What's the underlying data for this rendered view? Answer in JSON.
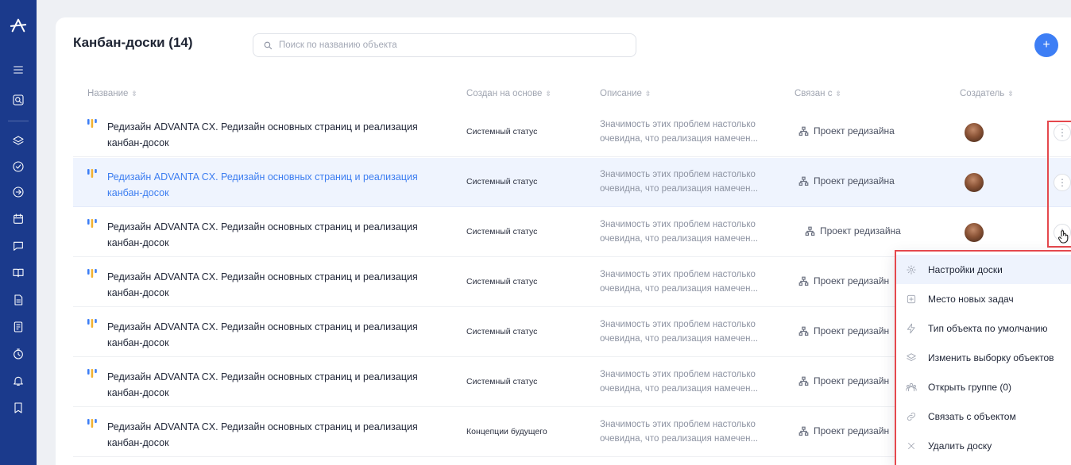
{
  "page": {
    "title": "Канбан-доски (14)",
    "search_placeholder": "Поиск по названию объекта",
    "add_label": "+"
  },
  "columns": [
    {
      "label": "Название"
    },
    {
      "label": "Создан на основе"
    },
    {
      "label": "Описание"
    },
    {
      "label": "Связан с"
    },
    {
      "label": "Создатель"
    }
  ],
  "rows": [
    {
      "name_line1": "Редизайн ADVANTA CX. Редизайн основных страниц и реализация",
      "name_line2": "канбан-досок",
      "based_on": "Системный статус",
      "desc_line1": "Значимость этих проблем настолько",
      "desc_line2": "очевидна, что реализация намечен...",
      "linked": "Проект редизайна"
    },
    {
      "name_line1": "Редизайн ADVANTA CX. Редизайн основных страниц и реализация",
      "name_line2": "канбан-досок",
      "based_on": "Системный статус",
      "desc_line1": "Значимость этих проблем настолько",
      "desc_line2": "очевидна, что реализация намечен...",
      "linked": "Проект редизайна"
    },
    {
      "name_line1": "Редизайн ADVANTA CX. Редизайн основных страниц и реализация",
      "name_line2": "канбан-досок",
      "based_on": "Системный статус",
      "desc_line1": "Значимость этих проблем настолько",
      "desc_line2": "очевидна, что реализация намечен...",
      "linked": "Проект редизайна"
    },
    {
      "name_line1": "Редизайн ADVANTA CX. Редизайн основных страниц и реализация",
      "name_line2": "канбан-досок",
      "based_on": "Системный статус",
      "desc_line1": "Значимость этих проблем настолько",
      "desc_line2": "очевидна, что реализация намечен...",
      "linked": "Проект редизайн"
    },
    {
      "name_line1": "Редизайн ADVANTA CX. Редизайн основных страниц и реализация",
      "name_line2": "канбан-досок",
      "based_on": "Системный статус",
      "desc_line1": "Значимость этих проблем настолько",
      "desc_line2": "очевидна, что реализация намечен...",
      "linked": "Проект редизайн"
    },
    {
      "name_line1": "Редизайн ADVANTA CX. Редизайн основных страниц и реализация",
      "name_line2": "канбан-досок",
      "based_on": "Системный статус",
      "desc_line1": "Значимость этих проблем настолько",
      "desc_line2": "очевидна, что реализация намечен...",
      "linked": "Проект редизайн"
    },
    {
      "name_line1": "Редизайн ADVANTA CX. Редизайн основных страниц и реализация",
      "name_line2": "канбан-досок",
      "based_on": "Концепции будущего",
      "desc_line1": "Значимость этих проблем настолько",
      "desc_line2": "очевидна, что реализация намечен...",
      "linked": "Проект редизайн"
    }
  ],
  "menu": {
    "items": [
      {
        "label": "Настройки доски",
        "icon": "gear-icon"
      },
      {
        "label": "Место новых задач",
        "icon": "plus-square-icon"
      },
      {
        "label": "Тип объекта по умолчанию",
        "icon": "lightning-icon"
      },
      {
        "label": "Изменить выборку объектов",
        "icon": "layers-icon"
      },
      {
        "label": "Открыть группе (0)",
        "icon": "group-icon"
      },
      {
        "label": "Связать с объектом",
        "icon": "link-icon"
      },
      {
        "label": "Удалить доску",
        "icon": "close-icon"
      }
    ]
  },
  "colors": {
    "sidebar": "#1b3a8c",
    "accent": "#3d7ef5",
    "highlight_row": "#eff4fe",
    "annotation": "#e5484d"
  }
}
